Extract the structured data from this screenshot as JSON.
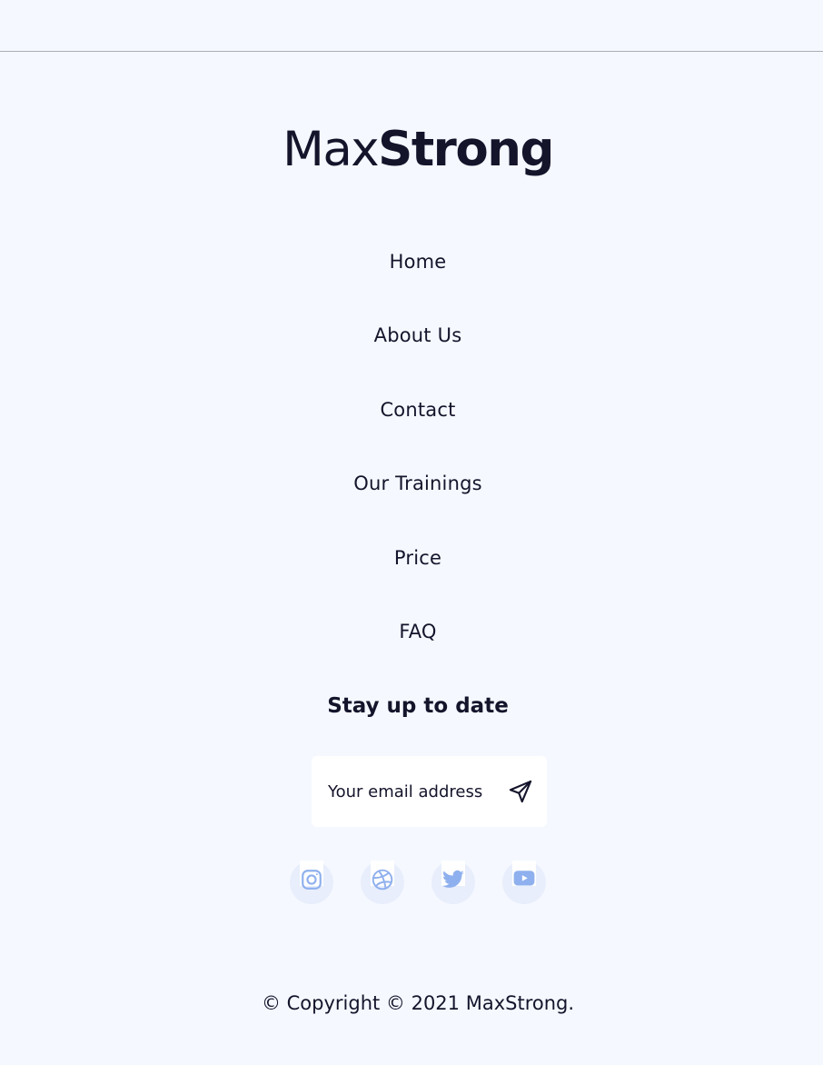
{
  "brand": {
    "name_light": "Max",
    "name_bold": "Strong"
  },
  "nav": {
    "items": [
      {
        "label": "Home"
      },
      {
        "label": "About Us"
      },
      {
        "label": "Contact"
      },
      {
        "label": "Our Trainings"
      },
      {
        "label": "Price"
      },
      {
        "label": "FAQ"
      }
    ]
  },
  "newsletter": {
    "heading": "Stay up to date",
    "placeholder": "Your email address",
    "send_icon": "paper-plane-icon"
  },
  "social": {
    "icons": [
      "instagram-icon",
      "dribbble-icon",
      "twitter-icon",
      "youtube-icon"
    ],
    "icon_color": "#8fb0ee",
    "circle_color": "#e8eefb"
  },
  "copyright": "© Copyright © 2021 MaxStrong.",
  "colors": {
    "background": "#f5f8ff",
    "text": "#14142b"
  }
}
